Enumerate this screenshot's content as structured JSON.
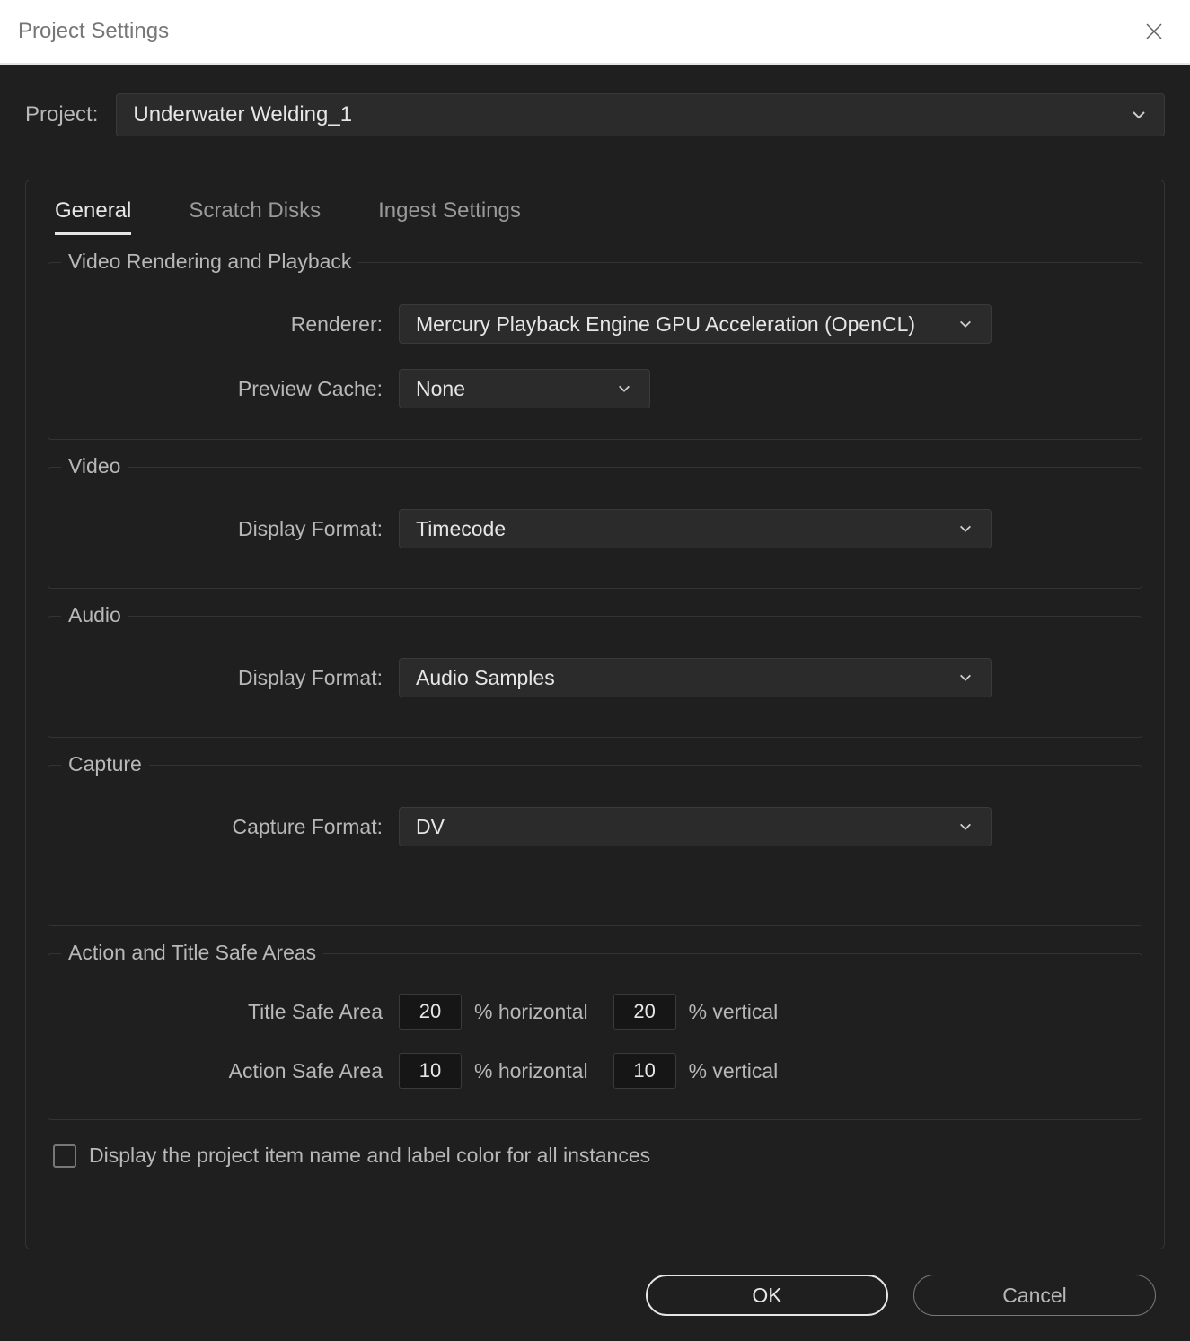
{
  "dialog": {
    "title": "Project Settings"
  },
  "project": {
    "label": "Project:",
    "name": "Underwater Welding_1"
  },
  "tabs": {
    "general": "General",
    "scratch": "Scratch Disks",
    "ingest": "Ingest Settings"
  },
  "groups": {
    "rendering": {
      "legend": "Video Rendering and Playback",
      "renderer_label": "Renderer:",
      "renderer_value": "Mercury Playback Engine GPU Acceleration (OpenCL)",
      "preview_label": "Preview Cache:",
      "preview_value": "None"
    },
    "video": {
      "legend": "Video",
      "display_label": "Display Format:",
      "display_value": "Timecode"
    },
    "audio": {
      "legend": "Audio",
      "display_label": "Display Format:",
      "display_value": "Audio Samples"
    },
    "capture": {
      "legend": "Capture",
      "format_label": "Capture Format:",
      "format_value": "DV"
    },
    "safe": {
      "legend": "Action and Title Safe Areas",
      "title_label": "Title Safe Area",
      "action_label": "Action Safe Area",
      "title_h": "20",
      "title_v": "20",
      "action_h": "10",
      "action_v": "10",
      "unit_h": "% horizontal",
      "unit_v": "% vertical"
    }
  },
  "checkbox": {
    "label": "Display the project item name and label color for all instances"
  },
  "buttons": {
    "ok": "OK",
    "cancel": "Cancel"
  }
}
